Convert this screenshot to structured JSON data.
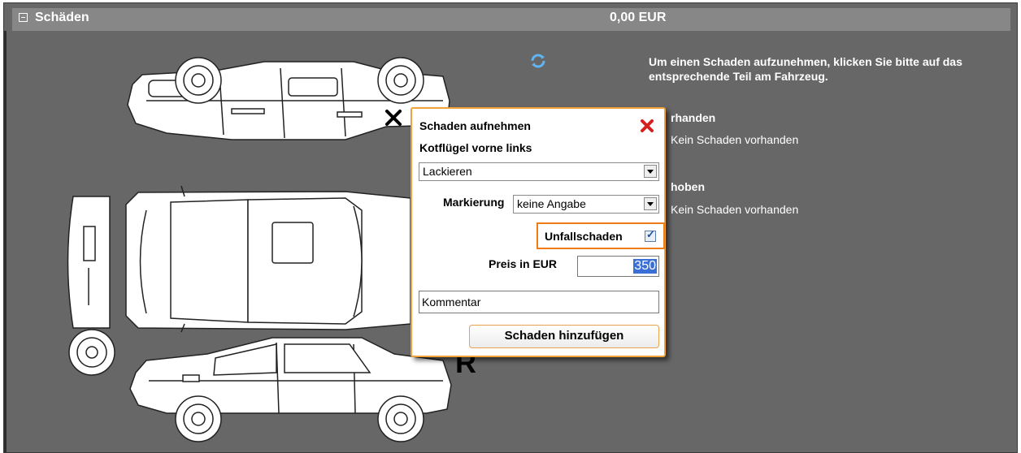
{
  "header": {
    "title": "Schäden",
    "total": "0,00 EUR"
  },
  "info": {
    "instruction": "Um einen Schaden aufzunehmen, klicken Sie bitte auf das entsprechende Teil am Fahrzeug.",
    "section1_title": "rhanden",
    "section1_value": "Kein Schaden vorhanden",
    "section2_title": "hoben",
    "section2_value": "Kein Schaden vorhanden"
  },
  "car_marker_letter": "R",
  "dialog": {
    "title": "Schaden aufnehmen",
    "part_name": "Kotflügel vorne links",
    "action_select": "Lackieren",
    "marker_label": "Markierung",
    "marker_select": "keine Angabe",
    "accident_label": "Unfallschaden",
    "accident_checked": true,
    "accident_check_glyph": "✓",
    "price_label": "Preis in EUR",
    "price_value": "350",
    "comment_value": "Kommentar",
    "add_button": "Schaden hinzufügen"
  },
  "icons": {
    "collapse": "collapse-icon",
    "refresh": "refresh-icon",
    "close": "close-icon",
    "damage_marker": "damage-marker-icon"
  },
  "colors": {
    "panel_bg": "#676767",
    "header_bg": "#878787",
    "dialog_border": "#f0a13a",
    "highlight_border": "#f07b14",
    "close_red": "#d42020",
    "selection_blue": "#3a6fd8"
  }
}
